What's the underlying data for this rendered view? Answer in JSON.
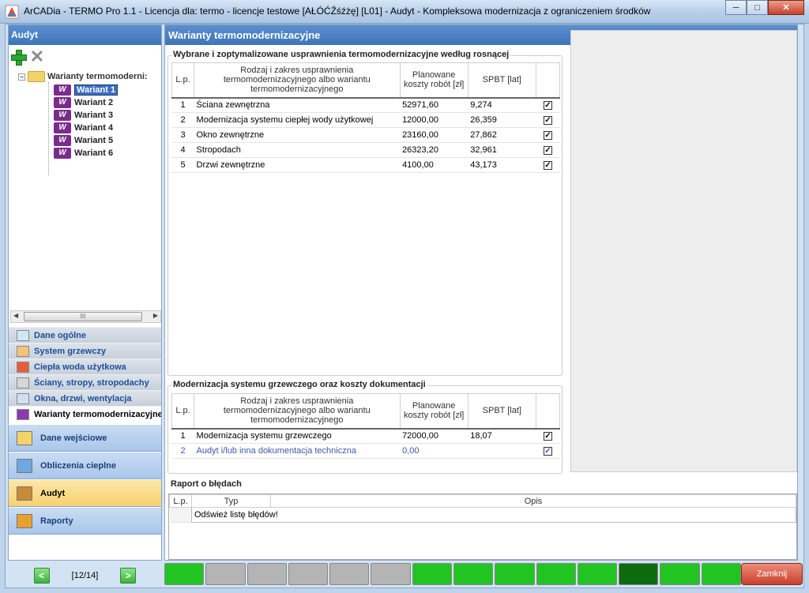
{
  "window": {
    "title": "ArCADia - TERMO Pro 1.1 - Licencja dla: termo - licencje testowe [AŁÓĆŹśźżę] [L01] - Audyt - Kompleksowa modernizacja z ograniczeniem środków",
    "minimize": "─",
    "maximize": "□",
    "close": "✕"
  },
  "left": {
    "header": "Audyt",
    "tree": {
      "root": "Warianty termomoderni:",
      "items": [
        "Wariant 1",
        "Wariant 2",
        "Wariant 3",
        "Wariant 4",
        "Wariant 5",
        "Wariant 6"
      ],
      "selected_index": 0,
      "icon_glyph": "W"
    },
    "scroll_thumb": "III",
    "nav": [
      {
        "label": "Dane ogólne"
      },
      {
        "label": "System grzewczy"
      },
      {
        "label": "Ciepła woda użytkowa"
      },
      {
        "label": "Ściany, stropy, stropodachy"
      },
      {
        "label": "Okna, drzwi, wentylacja"
      },
      {
        "label": "Warianty termomodernizacyjne"
      }
    ],
    "big_buttons": [
      {
        "label": "Dane wejściowe"
      },
      {
        "label": "Obliczenia cieplne"
      },
      {
        "label": "Audyt"
      },
      {
        "label": "Raporty"
      }
    ],
    "pager": {
      "prev": "<",
      "text": "[12/14]",
      "next": ">"
    }
  },
  "main": {
    "header": "Warianty termomodernizacyjne",
    "table1": {
      "title": "Wybrane i zoptymalizowane usprawnienia termomodernizacyjne według rosnącej",
      "columns": [
        "L.p.",
        "Rodzaj i zakres usprawnienia termomodernizacyjnego albo wariantu termomodernizacyjnego",
        "Planowane koszty robót [zł]",
        "SPBT [lat]",
        ""
      ],
      "rows": [
        {
          "lp": "1",
          "name": "Ściana zewnętrzna",
          "cost": "52971,60",
          "spbt": "9,274",
          "checked": "✓"
        },
        {
          "lp": "2",
          "name": "Modernizacja systemu ciepłej wody użytkowej",
          "cost": "12000,00",
          "spbt": "26,359",
          "checked": "✓"
        },
        {
          "lp": "3",
          "name": "Okno zewnętrzne",
          "cost": "23160,00",
          "spbt": "27,862",
          "checked": "✓"
        },
        {
          "lp": "4",
          "name": "Stropodach",
          "cost": "26323,20",
          "spbt": "32,961",
          "checked": "✓"
        },
        {
          "lp": "5",
          "name": "Drzwi zewnętrzne",
          "cost": "4100,00",
          "spbt": "43,173",
          "checked": "✓"
        }
      ]
    },
    "table2": {
      "title": "Modernizacja systemu grzewczego oraz koszty dokumentacji",
      "columns": [
        "L.p.",
        "Rodzaj i zakres usprawnienia termomodernizacyjnego albo wariantu termomodernizacyjnego",
        "Planowane koszty robót [zł]",
        "SPBT [lat]",
        ""
      ],
      "rows": [
        {
          "lp": "1",
          "name": "Modernizacja systemu grzewczego",
          "cost": "72000,00",
          "spbt": "18,07",
          "checked": "✓"
        },
        {
          "lp": "2",
          "name": "Audyt i/lub inna dokumentacja techniczna",
          "cost": "0,00",
          "spbt": "",
          "checked": "✓"
        }
      ]
    },
    "errors": {
      "title": "Raport o błędach",
      "columns": [
        "L.p.",
        "Typ",
        "Opis"
      ],
      "refresh_text": "Odśwież listę błędów!"
    }
  },
  "statusbar": {
    "segments": [
      "green",
      "gray",
      "gray",
      "gray",
      "gray",
      "gray",
      "green",
      "green",
      "green",
      "green",
      "green",
      "darkgreen",
      "green",
      "green"
    ],
    "close_label": "Zamknij"
  },
  "colors": {
    "green": "#22c422",
    "gray": "#b4b4b4",
    "darkgreen": "#0d6b0d"
  }
}
